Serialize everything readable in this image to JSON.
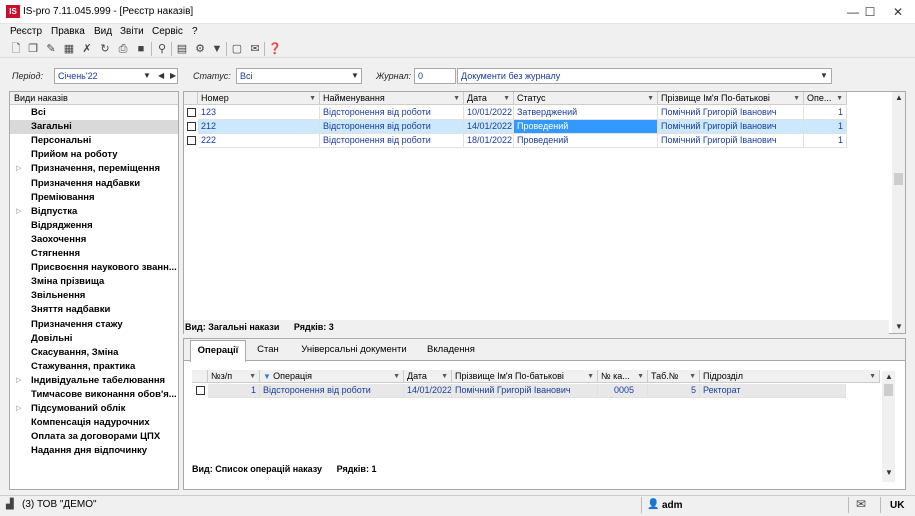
{
  "window": {
    "title": "IS-pro 7.11.045.999 - [Реєстр наказів]",
    "logo": "IS",
    "minimize": "—",
    "maximize": "☐",
    "close": "✕"
  },
  "menu": [
    "Реєстр",
    "Правка",
    "Вид",
    "Звіти",
    "Сервіс",
    "?"
  ],
  "toolbar_icons": [
    "new-doc-icon",
    "copy-icon",
    "edit-icon",
    "delete-icon",
    "table-icon",
    "cancel-icon",
    "refresh-icon",
    "print-icon",
    "export-icon",
    "search-icon",
    "grid-icon",
    "settings-icon",
    "filter-icon",
    "doc-icon",
    "mail-icon",
    "help-icon"
  ],
  "filters": {
    "period_label": "Період:",
    "period_value": "Січень'22",
    "status_label": "Статус:",
    "status_value": "Всі",
    "journal_label": "Журнал:",
    "journal_code": "0",
    "journal_name": "Документи без журналу"
  },
  "left_panel": {
    "header": "Види наказів",
    "items": [
      {
        "label": "Всі",
        "arrow": false
      },
      {
        "label": "Загальні",
        "arrow": false,
        "selected": true
      },
      {
        "label": "Персональні",
        "arrow": false
      },
      {
        "label": "Прийом на роботу",
        "arrow": false
      },
      {
        "label": "Призначення, переміщення",
        "arrow": true
      },
      {
        "label": "Призначення надбавки",
        "arrow": false
      },
      {
        "label": "Преміювання",
        "arrow": false
      },
      {
        "label": "Відпустка",
        "arrow": true
      },
      {
        "label": "Відрядження",
        "arrow": false
      },
      {
        "label": "Заохочення",
        "arrow": false
      },
      {
        "label": "Стягнення",
        "arrow": false
      },
      {
        "label": "Присвоєння наукового званн...",
        "arrow": false
      },
      {
        "label": "Зміна прізвища",
        "arrow": false
      },
      {
        "label": "Звільнення",
        "arrow": false
      },
      {
        "label": "Зняття надбавки",
        "arrow": false
      },
      {
        "label": "Призначення стажу",
        "arrow": false
      },
      {
        "label": "Довільні",
        "arrow": false
      },
      {
        "label": "Скасування, Зміна",
        "arrow": false
      },
      {
        "label": "Стажування, практика",
        "arrow": false
      },
      {
        "label": "Індивідуальне табелювання",
        "arrow": true
      },
      {
        "label": "Тимчасове виконання обов'я...",
        "arrow": false
      },
      {
        "label": "Підсумований облік",
        "arrow": true
      },
      {
        "label": "Компенсація надурочних",
        "arrow": false
      },
      {
        "label": "Оплата за договорами ЦПХ",
        "arrow": false
      },
      {
        "label": "Надання дня відпочинку",
        "arrow": false
      }
    ]
  },
  "main_grid": {
    "columns": [
      "Номер",
      "Найменування",
      "Дата",
      "Статус",
      "Прізвище Ім'я По-батькові",
      "Опе..."
    ],
    "rows": [
      {
        "num": "123",
        "name": "Відсторонення від роботи",
        "date": "10/01/2022",
        "status": "Затверджений",
        "person": "Помічний Григорій Іванович",
        "ops": "1"
      },
      {
        "num": "212",
        "name": "Відсторонення від роботи",
        "date": "14/01/2022",
        "status": "Проведений",
        "person": "Помічний Григорій Іванович",
        "ops": "1",
        "selected": true
      },
      {
        "num": "222",
        "name": "Відсторонення від роботи",
        "date": "18/01/2022",
        "status": "Проведений",
        "person": "Помічний Григорій Іванович",
        "ops": "1"
      }
    ],
    "footer_view": "Вид: Загальні накази",
    "footer_rows": "Рядків: 3"
  },
  "bottom": {
    "tabs": [
      "Операції",
      "Стан",
      "Універсальні документи",
      "Вкладення"
    ],
    "columns": [
      "№з/п",
      "Операція",
      "Дата",
      "Прізвище Ім'я По-батькові",
      "№ ка...",
      "Таб.№",
      "Підрозділ"
    ],
    "rows": [
      {
        "n": "1",
        "op": "Відсторонення від роботи",
        "date": "14/01/2022",
        "person": "Помічний Григорій Іванович",
        "card": "0005",
        "tab": "5",
        "dept": "Ректорат"
      }
    ],
    "footer_view": "Вид: Список операцій наказу",
    "footer_rows": "Рядків: 1"
  },
  "statusbar": {
    "company": "(3) ТОВ \"ДЕМО\"",
    "user": "adm",
    "lang": "UK"
  },
  "colors": {
    "selected_row": "#cce8ff",
    "selected_status": "#3399ff",
    "value_text": "#1a3d9e",
    "logo_red": "#c8102e"
  }
}
